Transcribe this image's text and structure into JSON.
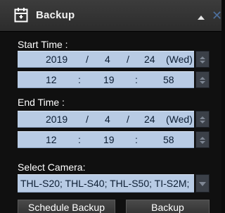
{
  "header": {
    "title": "Backup",
    "icon": "backup-icon",
    "collapse_icon": "chevron-up-icon",
    "close_icon": "close-icon"
  },
  "start_time": {
    "label": "Start Time :",
    "year": "2019",
    "month": "4",
    "day": "24",
    "weekday": "(Wed)",
    "hour": "12",
    "minute": "19",
    "second": "58",
    "date_sep": "/",
    "time_sep": ":"
  },
  "end_time": {
    "label": "End Time :",
    "year": "2019",
    "month": "4",
    "day": "24",
    "weekday": "(Wed)",
    "hour": "12",
    "minute": "19",
    "second": "58",
    "date_sep": "/",
    "time_sep": ":"
  },
  "camera": {
    "label": "Select Camera:",
    "value": "THL-S20; THL-S40; THL-S50; TI-S2M;"
  },
  "buttons": {
    "schedule_backup": "Schedule Backup",
    "backup": "Backup"
  },
  "colors": {
    "field_bg": "#b8cbe4",
    "accent": "#4d6f9c",
    "panel_bg": "#101010"
  }
}
